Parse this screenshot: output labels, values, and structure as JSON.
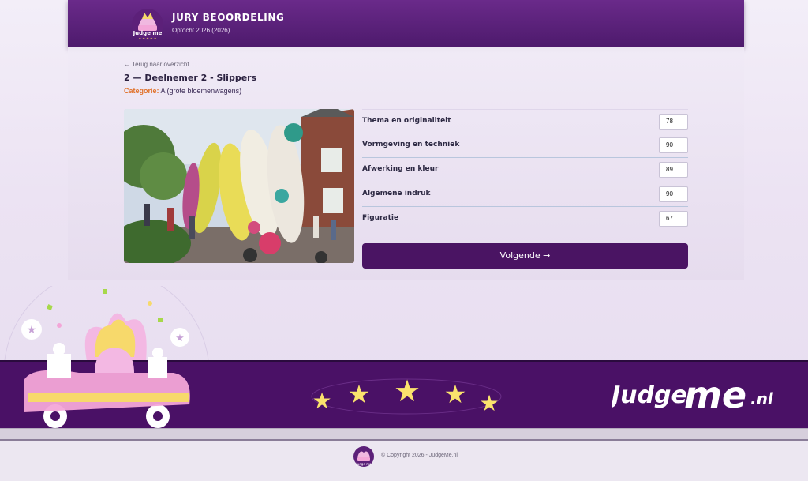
{
  "header": {
    "title": "JURY BEOORDELING",
    "subtitle": "Optocht 2026 (2026)"
  },
  "entry": {
    "back_link": "← Terug naar overzicht",
    "title": "2 — Deelnemer 2 - Slippers",
    "category_label": "Categorie:",
    "category_value": "A (grote bloemenwagens)"
  },
  "scores": [
    {
      "label": "Thema en originaliteit",
      "value": "78"
    },
    {
      "label": "Vormgeving en techniek",
      "value": "90"
    },
    {
      "label": "Afwerking en kleur",
      "value": "89"
    },
    {
      "label": "Algemene indruk",
      "value": "90"
    },
    {
      "label": "Figuratie",
      "value": "67"
    }
  ],
  "next_button": "Volgende →",
  "footer": {
    "brand_left": "Judge",
    "brand_mid": "me",
    "brand_right": ".nl",
    "copyright": "© Copyright 2026 - JudgeMe.nl",
    "star_count": 5
  },
  "colors": {
    "primary": "#4a1463",
    "header": "#5c2079",
    "accent_orange": "#e0722b",
    "star": "#fbe36d"
  }
}
